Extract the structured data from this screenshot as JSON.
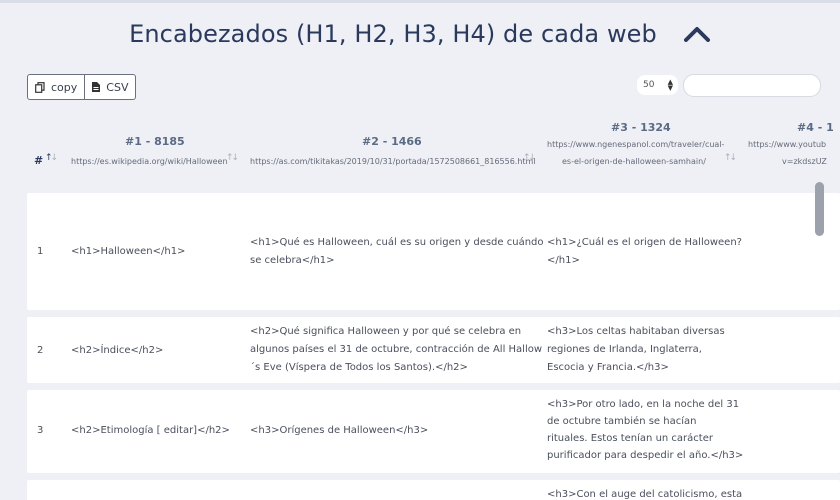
{
  "page_title": "Encabezados (H1, H2, H3, H4) de cada web",
  "toolbar": {
    "copy_label": "copy",
    "csv_label": "CSV"
  },
  "page_size": {
    "selected": "50"
  },
  "search": {
    "placeholder": ""
  },
  "columns": [
    {
      "label": "#"
    },
    {
      "title": "#1 - 8185",
      "url": "https://es.wikipedia.org/wiki/Halloween"
    },
    {
      "title": "#2 - 1466",
      "url": "https://as.com/tikitakas/2019/10/31/portada/1572508661_816556.html"
    },
    {
      "title": "#3 - 1324",
      "url_line1": "https://www.ngenespanol.com/traveler/cual-",
      "url_line2": "es-el-origen-de-halloween-samhain/"
    },
    {
      "title": "#4 - 1",
      "url_line1": "https://www.youtub",
      "url_line2": "v=zkdszUZ"
    }
  ],
  "rows": [
    {
      "n": "1",
      "c1": "<h1>Halloween</h1>",
      "c2": [
        "<h1>Qué es Halloween, cuál es su origen y desde cuándo",
        "se celebra</h1>"
      ],
      "c3": [
        "<h1>¿Cuál es el origen de Halloween?",
        "</h1>"
      ]
    },
    {
      "n": "2",
      "c1": "<h2>Índice</h2>",
      "c2": [
        "<h2>Qué significa Halloween y por qué se celebra en",
        "algunos países el 31 de octubre, contracción de All Hallow",
        "´s Eve (Víspera de Todos los Santos).</h2>"
      ],
      "c3": [
        "<h3>Los celtas habitaban diversas",
        "regiones de Irlanda, Inglaterra,",
        "Escocia y Francia.</h3>"
      ]
    },
    {
      "n": "3",
      "c1": "<h2>Etimología [ editar]</h2>",
      "c2": [
        "<h3>Orígenes de Halloween</h3>"
      ],
      "c3": [
        "<h3>Por otro lado, en la noche del 31",
        "de octubre también se hacían",
        "rituales. Estos tenían un carácter",
        "purificador para despedir el año.</h3>"
      ]
    },
    {
      "n": "",
      "c1": "",
      "c2": [],
      "c3": [
        "<h3>Con el auge del catolicismo, esta"
      ]
    }
  ]
}
